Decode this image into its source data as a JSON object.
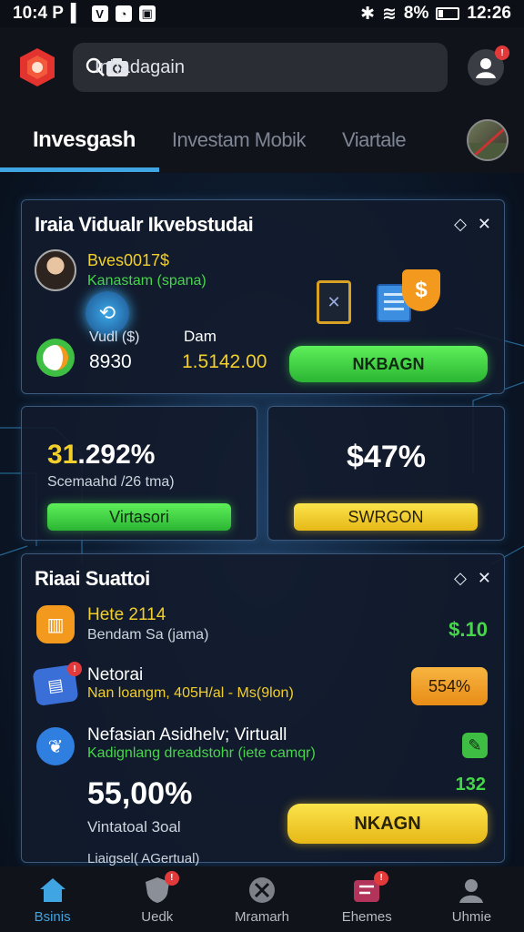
{
  "status_bar": {
    "time_left": "10:4 P",
    "battery": "8%",
    "time_right": "12:26"
  },
  "header": {
    "search_text": "Inhadagain"
  },
  "tabs": [
    {
      "label": "Invesgash",
      "active": true
    },
    {
      "label": "Investam Mobik",
      "active": false
    },
    {
      "label": "Viartale",
      "active": false
    }
  ],
  "card1": {
    "title": "Iraia Vidualr Ikvebstudai",
    "user_line1": "Bves0017$",
    "user_line2": "Kanastam (spana)",
    "stat1_label": "Vudl ($)",
    "stat1_value": "8930",
    "stat2_label": "Dam",
    "stat2_value": "1.5142.00",
    "button_label": "NKBAGN"
  },
  "card2": {
    "value": "31.292%",
    "sub": "Scemaahd /26 tma)",
    "button_label": "Virtasori"
  },
  "card3": {
    "value": "$47%",
    "button_label": "SWRGON"
  },
  "card4": {
    "title": "Riaai Suattoi",
    "items": [
      {
        "title": "Hete 2114",
        "sub": "Bendam Sa (jama)",
        "value": "$.10"
      },
      {
        "title": "Netorai",
        "sub": "Nan loangm, 405H/al - Ms(9lon)",
        "badge": "554%"
      },
      {
        "title": "Nefasian Asidhelv; Virtuall",
        "sub": "Kadignlang dreadstohr (iete camqr)",
        "value": "132"
      }
    ],
    "big_value": "55,00%",
    "big_sub": "Vintatoal 3oal",
    "button_label": "NKAGN",
    "footer": "Liaigsel( AGertual)"
  },
  "bottom_nav": [
    {
      "label": "Bsinis",
      "active": true
    },
    {
      "label": "Uedk",
      "active": false
    },
    {
      "label": "Mramarh",
      "active": false
    },
    {
      "label": "Ehemes",
      "active": false
    },
    {
      "label": "Uhmie",
      "active": false
    }
  ],
  "colors": {
    "accent_blue": "#3fa5e3",
    "green": "#46d64a",
    "yellow": "#f2cf2a",
    "orange": "#f39a1e",
    "badge_red": "#e23a3a"
  }
}
